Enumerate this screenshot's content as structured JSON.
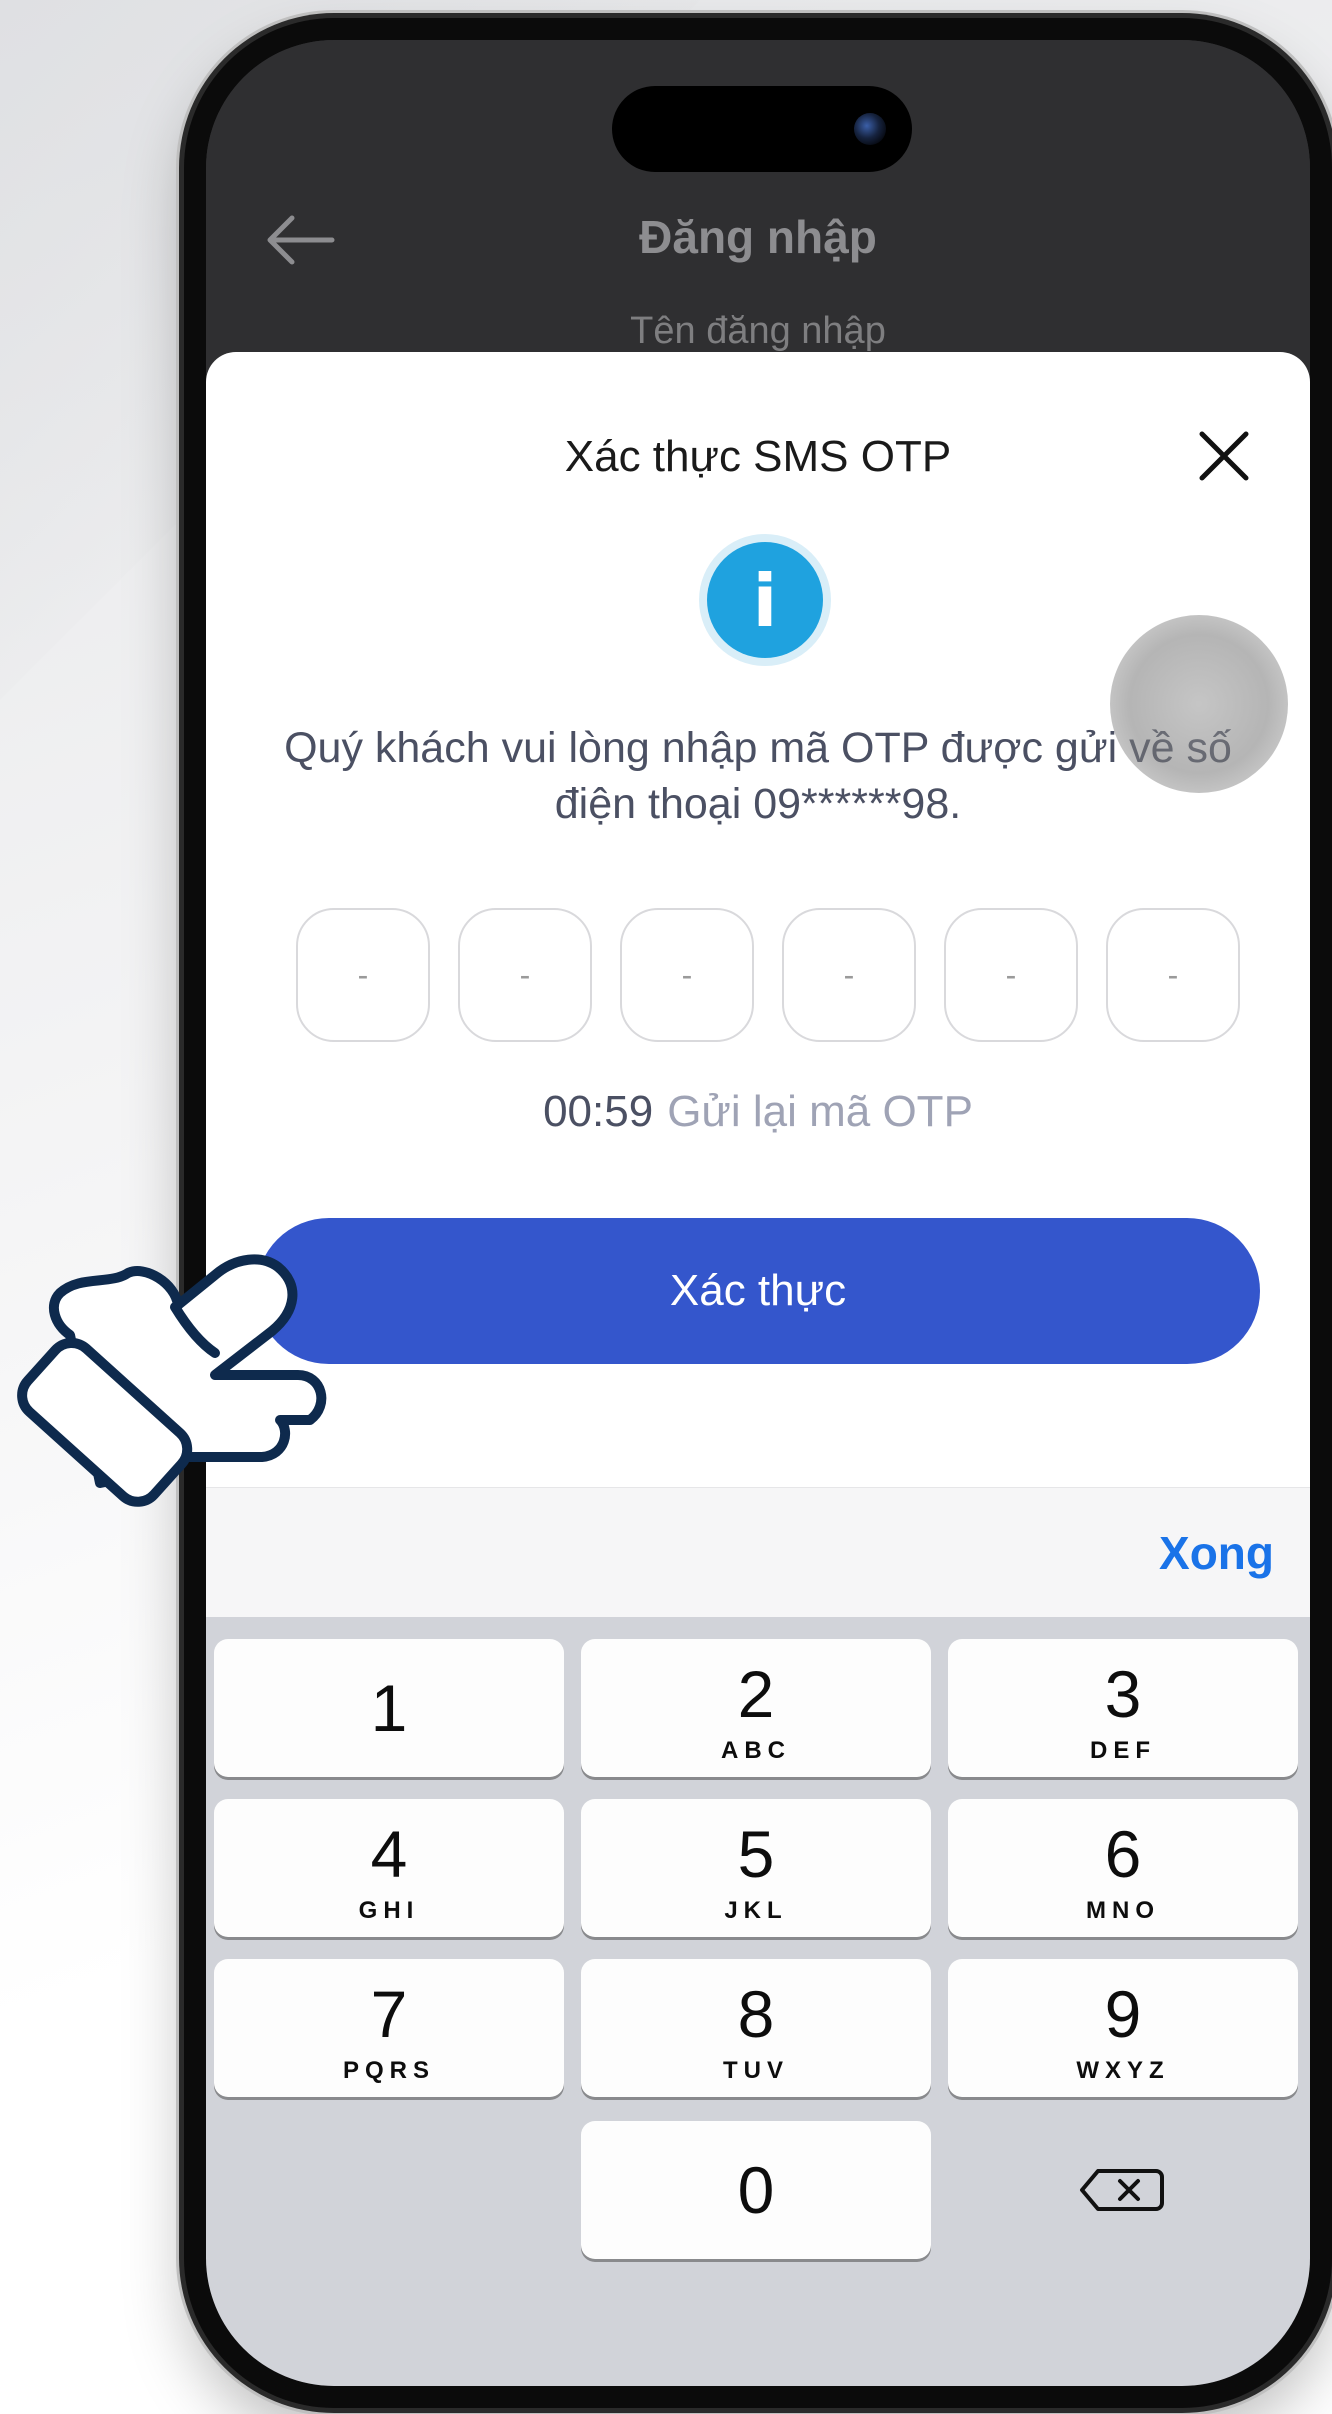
{
  "topbar": {
    "title": "Đăng nhập",
    "under_label": "Tên đăng nhập"
  },
  "otp_sheet": {
    "title": "Xác thực SMS OTP",
    "message": "Quý khách vui lòng nhập mã OTP được gửi về số điện thoại 09******98.",
    "otp_digits": [
      "-",
      "-",
      "-",
      "-",
      "-",
      "-"
    ],
    "timer": "00:59",
    "resend_label": "Gửi lại mã OTP",
    "verify_label": "Xác thực"
  },
  "keyboard": {
    "done_label": "Xong",
    "keys": [
      {
        "num": "1",
        "letters": ""
      },
      {
        "num": "2",
        "letters": "ABC"
      },
      {
        "num": "3",
        "letters": "DEF"
      },
      {
        "num": "4",
        "letters": "GHI"
      },
      {
        "num": "5",
        "letters": "JKL"
      },
      {
        "num": "6",
        "letters": "MNO"
      },
      {
        "num": "7",
        "letters": "PQRS"
      },
      {
        "num": "8",
        "letters": "TUV"
      },
      {
        "num": "9",
        "letters": "WXYZ"
      },
      {
        "num": "0",
        "letters": ""
      }
    ]
  },
  "colors": {
    "primary_button": "#3456cc",
    "info_icon": "#1fa2df",
    "done_link": "#1a73e8"
  },
  "icons": [
    "back-arrow-icon",
    "close-icon",
    "info-icon",
    "backspace-icon",
    "pointing-hand-icon"
  ]
}
